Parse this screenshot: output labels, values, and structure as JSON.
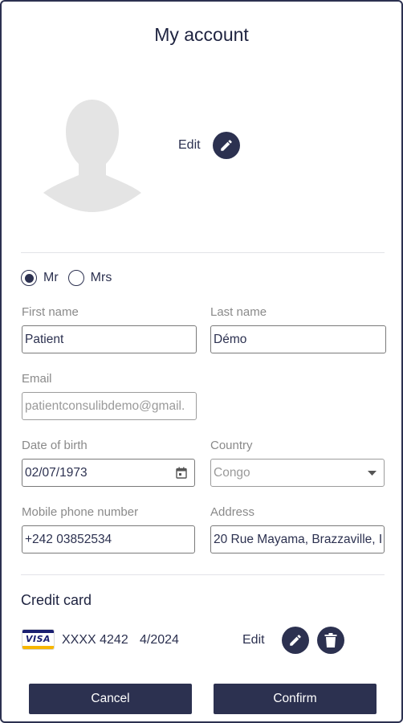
{
  "header": {
    "title": "My account"
  },
  "profile": {
    "edit_label": "Edit"
  },
  "gender": {
    "options": [
      {
        "label": "Mr",
        "selected": true
      },
      {
        "label": "Mrs",
        "selected": false
      }
    ]
  },
  "form": {
    "first_name": {
      "label": "First name",
      "value": "Patient"
    },
    "last_name": {
      "label": "Last name",
      "value": "Démo"
    },
    "email": {
      "label": "Email",
      "value": "patientconsulibdemo@gmail."
    },
    "dob": {
      "label": "Date of birth",
      "value": "02/07/1973"
    },
    "country": {
      "label": "Country",
      "value": "Congo"
    },
    "mobile": {
      "label": "Mobile phone number",
      "value": "+242 03852534"
    },
    "address": {
      "label": "Address",
      "value": "20 Rue Mayama, Brazzaville, I"
    }
  },
  "credit_card": {
    "title": "Credit card",
    "brand": "VISA",
    "number": "XXXX 4242",
    "expiry": "4/2024",
    "edit_label": "Edit"
  },
  "actions": {
    "cancel_label": "Cancel",
    "confirm_label": "Confirm"
  },
  "icons": {
    "avatar": "user-silhouette-icon",
    "edit": "pencil-icon",
    "delete": "trash-icon",
    "date": "calendar-icon",
    "dropdown": "caret-down-icon"
  },
  "colors": {
    "primary": "#2c3150",
    "label": "#8a8a8a",
    "avatar": "#e4e4e4"
  }
}
